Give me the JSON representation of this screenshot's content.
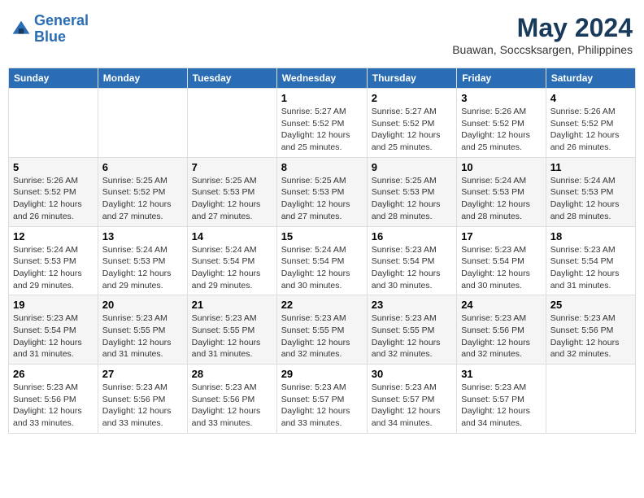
{
  "logo": {
    "line1": "General",
    "line2": "Blue"
  },
  "title": "May 2024",
  "location": "Buawan, Soccsksargen, Philippines",
  "weekdays": [
    "Sunday",
    "Monday",
    "Tuesday",
    "Wednesday",
    "Thursday",
    "Friday",
    "Saturday"
  ],
  "weeks": [
    [
      null,
      null,
      null,
      {
        "day": "1",
        "sunrise": "Sunrise: 5:27 AM",
        "sunset": "Sunset: 5:52 PM",
        "daylight": "Daylight: 12 hours and 25 minutes."
      },
      {
        "day": "2",
        "sunrise": "Sunrise: 5:27 AM",
        "sunset": "Sunset: 5:52 PM",
        "daylight": "Daylight: 12 hours and 25 minutes."
      },
      {
        "day": "3",
        "sunrise": "Sunrise: 5:26 AM",
        "sunset": "Sunset: 5:52 PM",
        "daylight": "Daylight: 12 hours and 25 minutes."
      },
      {
        "day": "4",
        "sunrise": "Sunrise: 5:26 AM",
        "sunset": "Sunset: 5:52 PM",
        "daylight": "Daylight: 12 hours and 26 minutes."
      }
    ],
    [
      {
        "day": "5",
        "sunrise": "Sunrise: 5:26 AM",
        "sunset": "Sunset: 5:52 PM",
        "daylight": "Daylight: 12 hours and 26 minutes."
      },
      {
        "day": "6",
        "sunrise": "Sunrise: 5:25 AM",
        "sunset": "Sunset: 5:52 PM",
        "daylight": "Daylight: 12 hours and 27 minutes."
      },
      {
        "day": "7",
        "sunrise": "Sunrise: 5:25 AM",
        "sunset": "Sunset: 5:53 PM",
        "daylight": "Daylight: 12 hours and 27 minutes."
      },
      {
        "day": "8",
        "sunrise": "Sunrise: 5:25 AM",
        "sunset": "Sunset: 5:53 PM",
        "daylight": "Daylight: 12 hours and 27 minutes."
      },
      {
        "day": "9",
        "sunrise": "Sunrise: 5:25 AM",
        "sunset": "Sunset: 5:53 PM",
        "daylight": "Daylight: 12 hours and 28 minutes."
      },
      {
        "day": "10",
        "sunrise": "Sunrise: 5:24 AM",
        "sunset": "Sunset: 5:53 PM",
        "daylight": "Daylight: 12 hours and 28 minutes."
      },
      {
        "day": "11",
        "sunrise": "Sunrise: 5:24 AM",
        "sunset": "Sunset: 5:53 PM",
        "daylight": "Daylight: 12 hours and 28 minutes."
      }
    ],
    [
      {
        "day": "12",
        "sunrise": "Sunrise: 5:24 AM",
        "sunset": "Sunset: 5:53 PM",
        "daylight": "Daylight: 12 hours and 29 minutes."
      },
      {
        "day": "13",
        "sunrise": "Sunrise: 5:24 AM",
        "sunset": "Sunset: 5:53 PM",
        "daylight": "Daylight: 12 hours and 29 minutes."
      },
      {
        "day": "14",
        "sunrise": "Sunrise: 5:24 AM",
        "sunset": "Sunset: 5:54 PM",
        "daylight": "Daylight: 12 hours and 29 minutes."
      },
      {
        "day": "15",
        "sunrise": "Sunrise: 5:24 AM",
        "sunset": "Sunset: 5:54 PM",
        "daylight": "Daylight: 12 hours and 30 minutes."
      },
      {
        "day": "16",
        "sunrise": "Sunrise: 5:23 AM",
        "sunset": "Sunset: 5:54 PM",
        "daylight": "Daylight: 12 hours and 30 minutes."
      },
      {
        "day": "17",
        "sunrise": "Sunrise: 5:23 AM",
        "sunset": "Sunset: 5:54 PM",
        "daylight": "Daylight: 12 hours and 30 minutes."
      },
      {
        "day": "18",
        "sunrise": "Sunrise: 5:23 AM",
        "sunset": "Sunset: 5:54 PM",
        "daylight": "Daylight: 12 hours and 31 minutes."
      }
    ],
    [
      {
        "day": "19",
        "sunrise": "Sunrise: 5:23 AM",
        "sunset": "Sunset: 5:54 PM",
        "daylight": "Daylight: 12 hours and 31 minutes."
      },
      {
        "day": "20",
        "sunrise": "Sunrise: 5:23 AM",
        "sunset": "Sunset: 5:55 PM",
        "daylight": "Daylight: 12 hours and 31 minutes."
      },
      {
        "day": "21",
        "sunrise": "Sunrise: 5:23 AM",
        "sunset": "Sunset: 5:55 PM",
        "daylight": "Daylight: 12 hours and 31 minutes."
      },
      {
        "day": "22",
        "sunrise": "Sunrise: 5:23 AM",
        "sunset": "Sunset: 5:55 PM",
        "daylight": "Daylight: 12 hours and 32 minutes."
      },
      {
        "day": "23",
        "sunrise": "Sunrise: 5:23 AM",
        "sunset": "Sunset: 5:55 PM",
        "daylight": "Daylight: 12 hours and 32 minutes."
      },
      {
        "day": "24",
        "sunrise": "Sunrise: 5:23 AM",
        "sunset": "Sunset: 5:56 PM",
        "daylight": "Daylight: 12 hours and 32 minutes."
      },
      {
        "day": "25",
        "sunrise": "Sunrise: 5:23 AM",
        "sunset": "Sunset: 5:56 PM",
        "daylight": "Daylight: 12 hours and 32 minutes."
      }
    ],
    [
      {
        "day": "26",
        "sunrise": "Sunrise: 5:23 AM",
        "sunset": "Sunset: 5:56 PM",
        "daylight": "Daylight: 12 hours and 33 minutes."
      },
      {
        "day": "27",
        "sunrise": "Sunrise: 5:23 AM",
        "sunset": "Sunset: 5:56 PM",
        "daylight": "Daylight: 12 hours and 33 minutes."
      },
      {
        "day": "28",
        "sunrise": "Sunrise: 5:23 AM",
        "sunset": "Sunset: 5:56 PM",
        "daylight": "Daylight: 12 hours and 33 minutes."
      },
      {
        "day": "29",
        "sunrise": "Sunrise: 5:23 AM",
        "sunset": "Sunset: 5:57 PM",
        "daylight": "Daylight: 12 hours and 33 minutes."
      },
      {
        "day": "30",
        "sunrise": "Sunrise: 5:23 AM",
        "sunset": "Sunset: 5:57 PM",
        "daylight": "Daylight: 12 hours and 34 minutes."
      },
      {
        "day": "31",
        "sunrise": "Sunrise: 5:23 AM",
        "sunset": "Sunset: 5:57 PM",
        "daylight": "Daylight: 12 hours and 34 minutes."
      },
      null
    ]
  ]
}
